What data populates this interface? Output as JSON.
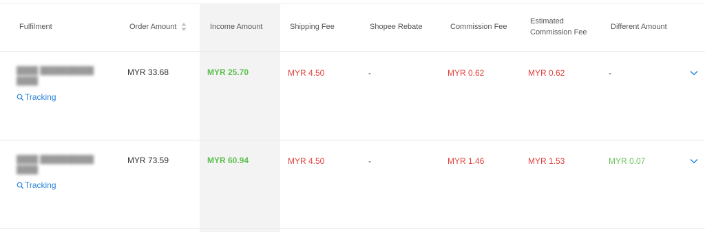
{
  "headers": {
    "fulfilment": "Fulfilment",
    "order_amount": "Order Amount",
    "income_amount": "Income Amount",
    "shipping_fee": "Shipping Fee",
    "shopee_rebate": "Shopee Rebate",
    "commission_fee": "Commission Fee",
    "estimated_commission_fee_line1": "Estimated",
    "estimated_commission_fee_line2": "Commission Fee",
    "different_amount": "Different Amount"
  },
  "rows": [
    {
      "tracking_label": "Tracking",
      "order_amount": "MYR 33.68",
      "income_amount": "MYR 25.70",
      "shipping_fee": "MYR 4.50",
      "shopee_rebate": "-",
      "commission_fee": "MYR 0.62",
      "estimated_commission_fee": "MYR 0.62",
      "different_amount": "-"
    },
    {
      "tracking_label": "Tracking",
      "order_amount": "MYR 73.59",
      "income_amount": "MYR 60.94",
      "shipping_fee": "MYR 4.50",
      "shopee_rebate": "-",
      "commission_fee": "MYR 1.46",
      "estimated_commission_fee": "MYR 1.53",
      "different_amount": "MYR 0.07"
    }
  ],
  "icons": {
    "sort": "sort-icon",
    "search": "search-icon",
    "expand": "chevron-down-icon"
  },
  "colors": {
    "income": "#5cbf4f",
    "fee": "#e0413c",
    "positive": "#6cc25b",
    "link": "#2b84d8",
    "income_column_bg": "#f3f3f3"
  }
}
